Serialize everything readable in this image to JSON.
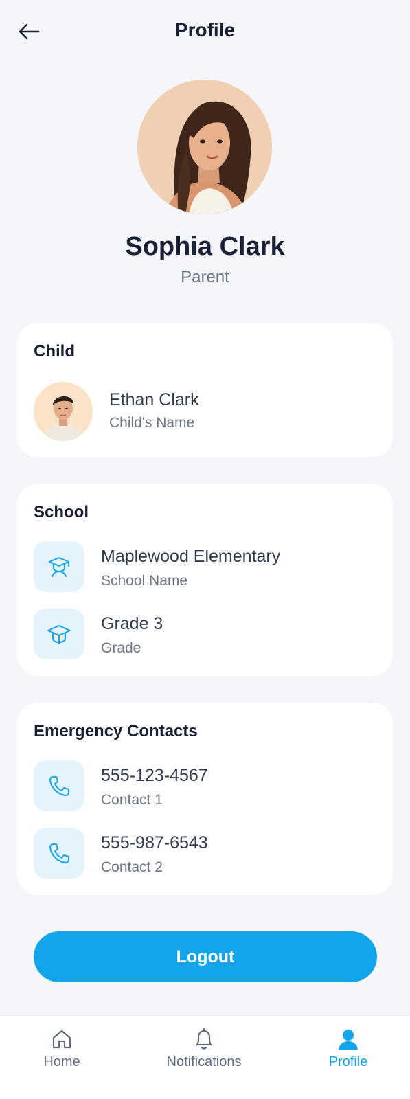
{
  "header": {
    "title": "Profile",
    "back_icon": "arrow-left-icon"
  },
  "profile": {
    "name": "Sophia Clark",
    "role": "Parent"
  },
  "child_card": {
    "title": "Child",
    "child_name": "Ethan Clark",
    "child_label": "Child's Name"
  },
  "school_card": {
    "title": "School",
    "items": [
      {
        "value": "Maplewood Elementary",
        "label": "School Name",
        "icon": "school-icon"
      },
      {
        "value": "Grade 3",
        "label": "Grade",
        "icon": "graduation-cap-icon"
      }
    ]
  },
  "contacts_card": {
    "title": "Emergency Contacts",
    "items": [
      {
        "value": "555-123-4567",
        "label": "Contact 1",
        "icon": "phone-icon"
      },
      {
        "value": "555-987-6543",
        "label": "Contact 2",
        "icon": "phone-icon"
      }
    ]
  },
  "logout_label": "Logout",
  "nav": {
    "items": [
      {
        "label": "Home",
        "icon": "home-icon",
        "active": false
      },
      {
        "label": "Notifications",
        "icon": "bell-icon",
        "active": false
      },
      {
        "label": "Profile",
        "icon": "user-icon",
        "active": true
      }
    ]
  },
  "colors": {
    "accent": "#14a4ea",
    "background": "#f4f6f9",
    "card": "#ffffff",
    "icon_box": "#e5f3fc",
    "text_primary": "#1a2035",
    "text_secondary": "#6b7688"
  }
}
